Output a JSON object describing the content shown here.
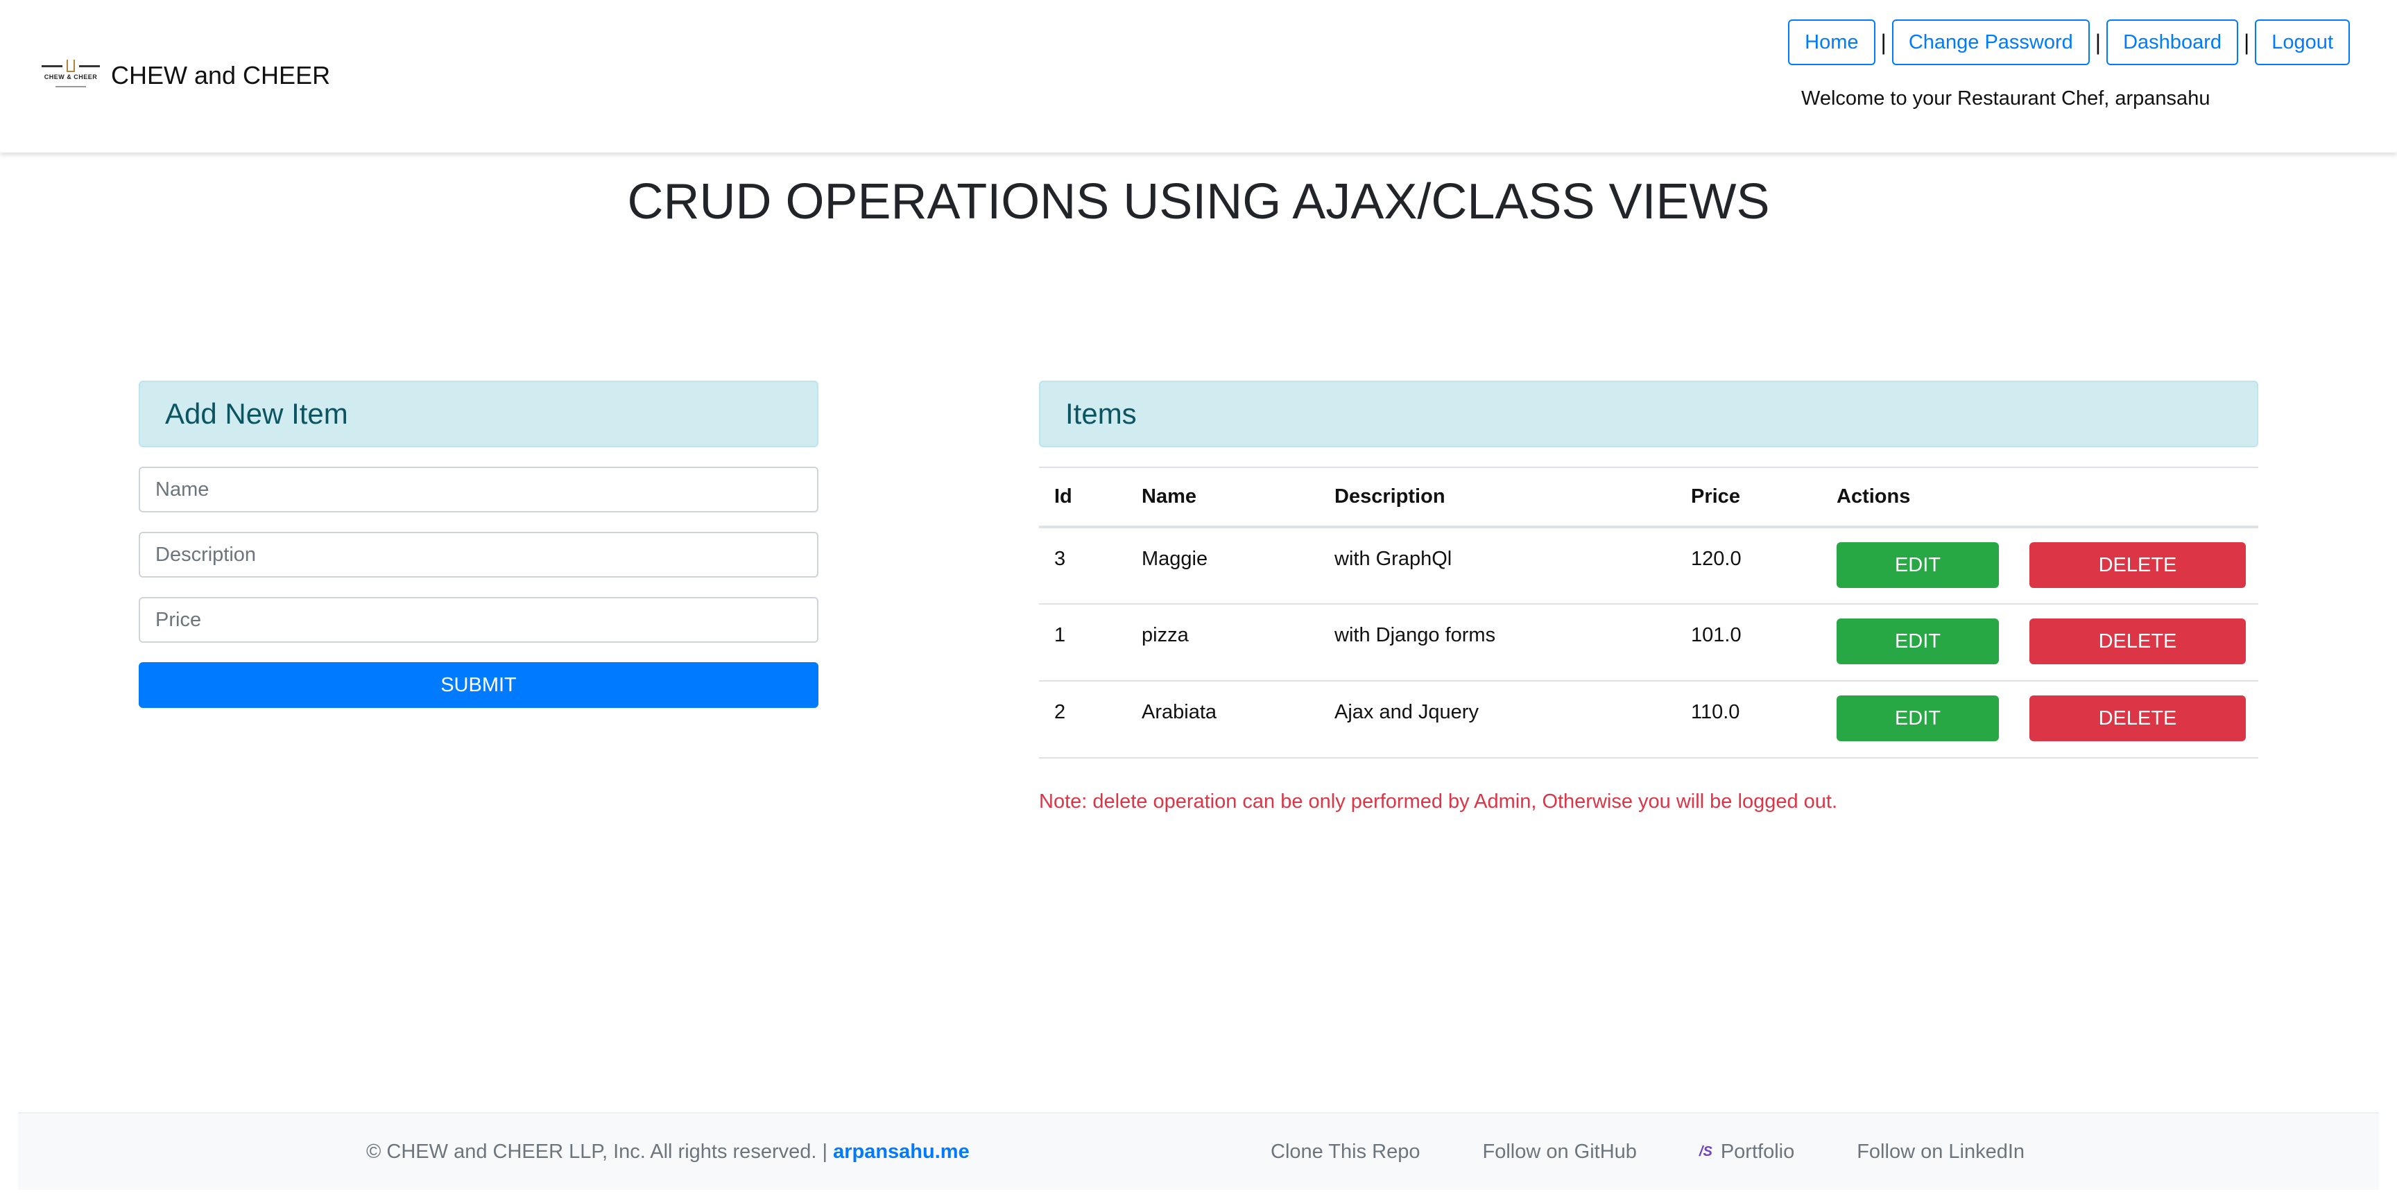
{
  "header": {
    "brand_name": "CHEW and CHEER",
    "logo_text": "CHEW & CHEER",
    "nav": {
      "home": "Home",
      "change_password": "Change Password",
      "dashboard": "Dashboard",
      "logout": "Logout",
      "separator": "|"
    },
    "welcome": "Welcome to your Restaurant Chef, arpansahu"
  },
  "page_title": "CRUD OPERATIONS USING AJAX/CLASS VIEWS",
  "form": {
    "title": "Add New Item",
    "name_placeholder": "Name",
    "description_placeholder": "Description",
    "price_placeholder": "Price",
    "submit_label": "SUBMIT"
  },
  "items": {
    "title": "Items",
    "columns": [
      "Id",
      "Name",
      "Description",
      "Price",
      "Actions"
    ],
    "rows": [
      {
        "id": "3",
        "name": "Maggie",
        "description": "with GraphQl",
        "price": "120.0"
      },
      {
        "id": "1",
        "name": "pizza",
        "description": "with Django forms",
        "price": "101.0"
      },
      {
        "id": "2",
        "name": "Arabiata",
        "description": "Ajax and Jquery",
        "price": "110.0"
      }
    ],
    "edit_label": "EDIT",
    "delete_label": "DELETE",
    "note": "Note: delete operation can be only performed by Admin, Otherwise you will be logged out."
  },
  "footer": {
    "copyright": "© CHEW and CHEER LLP, Inc. All rights reserved. |",
    "site_link": "arpansahu.me",
    "clone": "Clone This Repo",
    "github": "Follow on GitHub",
    "portfolio": "Portfolio",
    "linkedin": "Follow on LinkedIn"
  },
  "colors": {
    "primary": "#007bff",
    "success": "#28a745",
    "danger": "#dc3545",
    "info_bg": "#d1ecf1",
    "info_text": "#0c5460"
  }
}
